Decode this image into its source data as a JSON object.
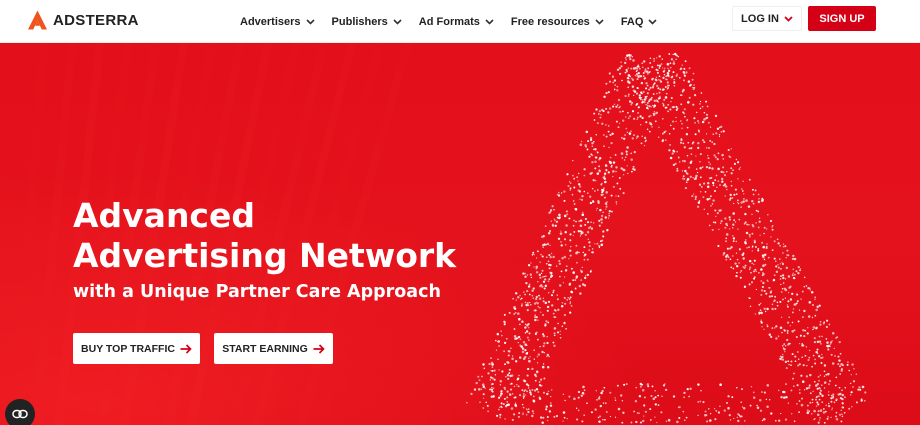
{
  "brand": {
    "name": "ADSTERRA",
    "logo_icon": "adsterra-triangle-logo",
    "accent": "#d40016"
  },
  "nav": {
    "items": [
      {
        "label": "Advertisers",
        "icon": "chevron-down-icon"
      },
      {
        "label": "Publishers",
        "icon": "chevron-down-icon"
      },
      {
        "label": "Ad Formats",
        "icon": "chevron-down-icon"
      },
      {
        "label": "Free resources",
        "icon": "chevron-down-icon"
      },
      {
        "label": "FAQ",
        "icon": "chevron-down-icon"
      }
    ]
  },
  "auth": {
    "login_label": "LOG IN",
    "signup_label": "SIGN UP"
  },
  "hero": {
    "title_line1": "Advanced",
    "title_line2": "Advertising Network",
    "subtitle": "with a Unique Partner Care Approach",
    "buttons": {
      "buy_label": "BUY TOP TRAFFIC",
      "start_label": "START EARNING"
    },
    "background_color": "#e3101b"
  },
  "widget": {
    "icon": "accessibility-icon"
  }
}
